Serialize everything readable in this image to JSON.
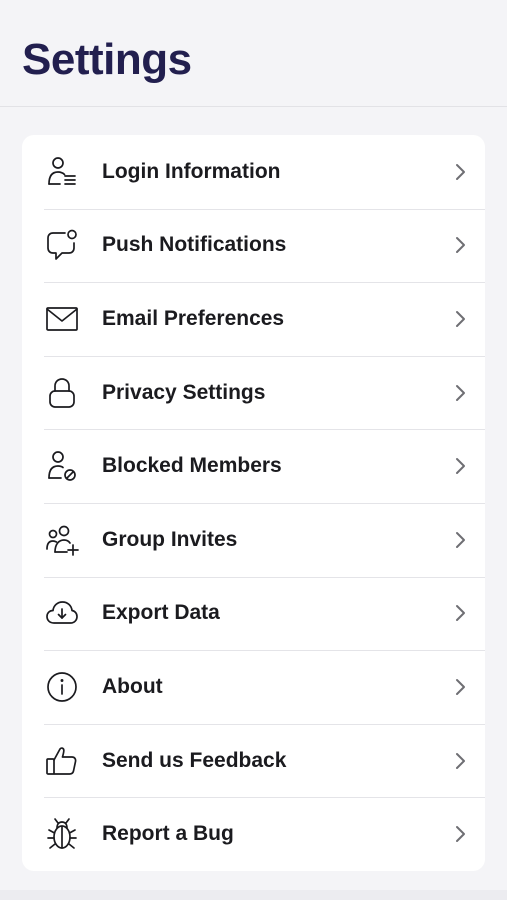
{
  "header": {
    "title": "Settings"
  },
  "menu": {
    "items": [
      {
        "label": "Login Information",
        "icon": "user-list-icon"
      },
      {
        "label": "Push Notifications",
        "icon": "chat-bubble-badge-icon"
      },
      {
        "label": "Email Preferences",
        "icon": "envelope-icon"
      },
      {
        "label": "Privacy Settings",
        "icon": "lock-icon"
      },
      {
        "label": "Blocked Members",
        "icon": "user-blocked-icon"
      },
      {
        "label": "Group Invites",
        "icon": "group-add-icon"
      },
      {
        "label": "Export Data",
        "icon": "cloud-download-icon"
      },
      {
        "label": "About",
        "icon": "info-icon"
      },
      {
        "label": "Send us Feedback",
        "icon": "thumbs-up-icon"
      },
      {
        "label": "Report a Bug",
        "icon": "bug-icon"
      }
    ]
  },
  "colors": {
    "title": "#221f4f",
    "background": "#f4f4f7",
    "card": "#ffffff",
    "text": "#1b1b1f",
    "chevron": "#6e6e73"
  }
}
